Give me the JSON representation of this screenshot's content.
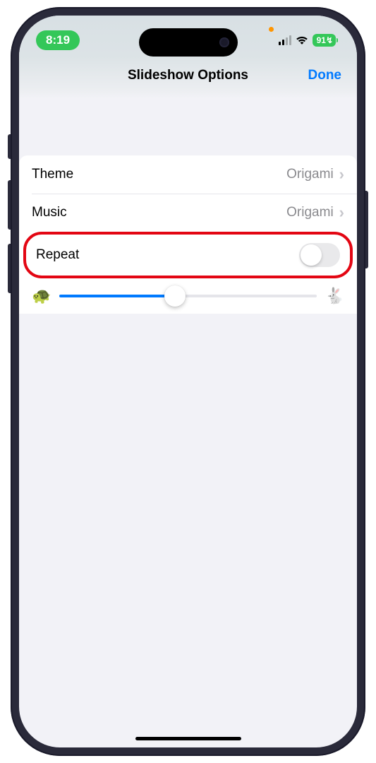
{
  "status": {
    "time": "8:19",
    "battery": "91",
    "battery_charging_glyph": "↯"
  },
  "header": {
    "title": "Slideshow Options",
    "done_label": "Done"
  },
  "rows": {
    "theme": {
      "label": "Theme",
      "value": "Origami"
    },
    "music": {
      "label": "Music",
      "value": "Origami"
    },
    "repeat": {
      "label": "Repeat",
      "on": false
    }
  },
  "slider": {
    "slow_icon": "🐢",
    "fast_icon": "🐇",
    "percent": 45
  }
}
